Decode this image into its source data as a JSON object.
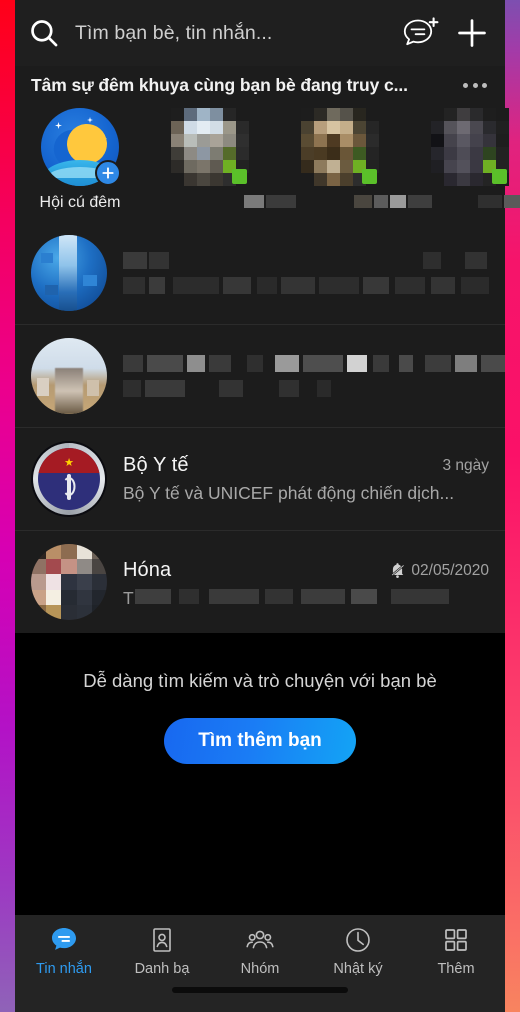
{
  "header": {
    "search_icon": "search-icon",
    "search_placeholder": "Tìm bạn bè, tin nhắn...",
    "new_message_icon": "new-message-icon",
    "add_icon": "plus-icon"
  },
  "story_section": {
    "title": "Tâm sự đêm khuya cùng bạn bè đang truy c...",
    "more_icon": "more-options-icon",
    "items": [
      {
        "label": "Hội cú đêm",
        "type": "create",
        "badge_icon": "plus-badge-icon",
        "online": false
      },
      {
        "label": "",
        "type": "censored",
        "online": true
      },
      {
        "label": "",
        "type": "censored",
        "online": true
      },
      {
        "label": "",
        "type": "censored",
        "online": true
      }
    ]
  },
  "chats": [
    {
      "name": "",
      "preview": "",
      "time": "",
      "muted": false,
      "censored": true
    },
    {
      "name": "",
      "preview": "",
      "time": "",
      "muted": false,
      "censored": true
    },
    {
      "name": "Bộ Y tế",
      "preview": "Bộ Y tế và UNICEF phát động chiến dịch...",
      "time": "3 ngày",
      "muted": false,
      "censored": false
    },
    {
      "name": "Hóna",
      "preview": "T",
      "time": "02/05/2020",
      "muted": true,
      "mute_icon": "bell-muted-icon",
      "censored": true
    }
  ],
  "empty_state": {
    "text": "Dễ dàng tìm kiếm và trò chuyện với bạn bè",
    "button_label": "Tìm thêm bạn"
  },
  "bottom_nav": {
    "items": [
      {
        "label": "Tin nhắn",
        "icon": "message-icon",
        "active": true
      },
      {
        "label": "Danh bạ",
        "icon": "contacts-icon",
        "active": false
      },
      {
        "label": "Nhóm",
        "icon": "group-icon",
        "active": false
      },
      {
        "label": "Nhật ký",
        "icon": "clock-icon",
        "active": false
      },
      {
        "label": "Thêm",
        "icon": "grid-icon",
        "active": false
      }
    ]
  },
  "colors": {
    "accent": "#2e9bf0",
    "button_gradient_start": "#1868f0",
    "button_gradient_end": "#13a4f5",
    "online": "#5bc02a",
    "panel": "#1c1c1c",
    "header": "#1f1f1f",
    "nav": "#242424",
    "background": "#000000"
  }
}
